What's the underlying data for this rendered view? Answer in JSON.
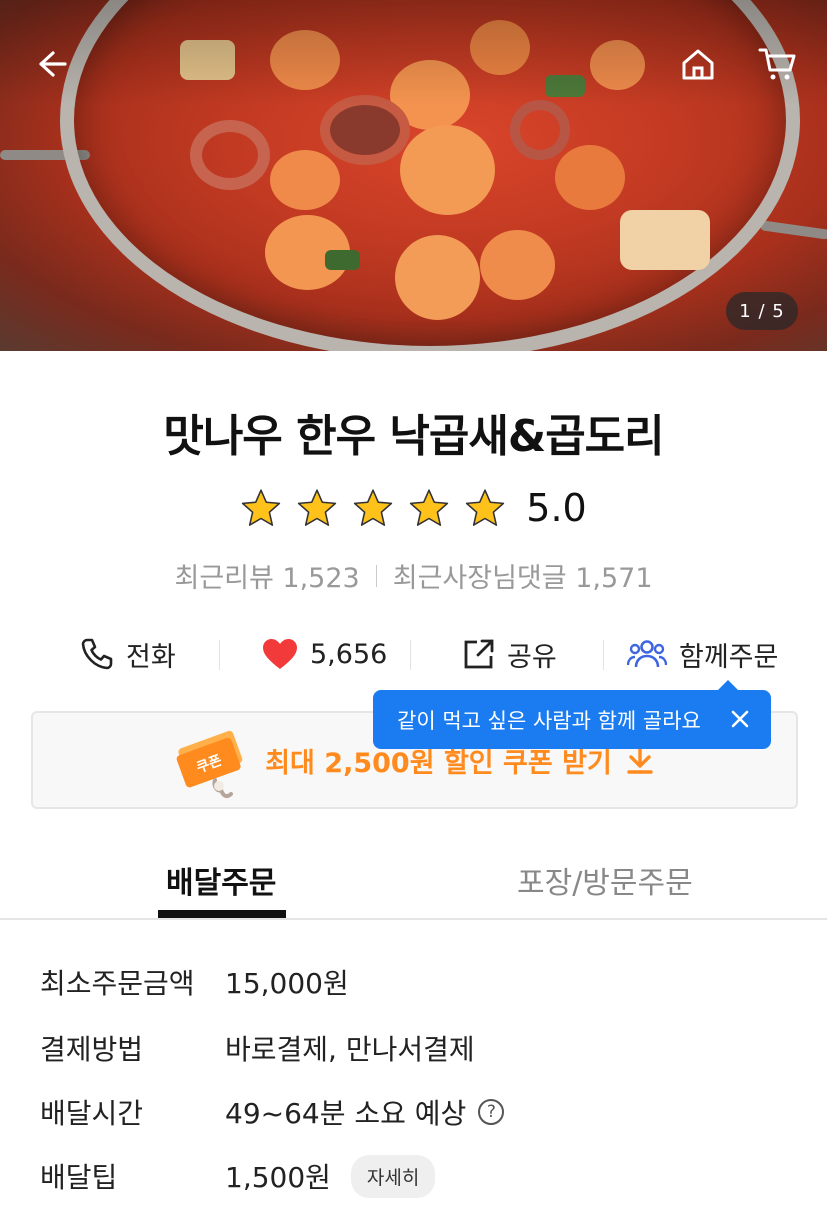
{
  "hero": {
    "counter": "1 / 5",
    "icons": [
      "back-arrow-icon",
      "home-icon",
      "cart-icon"
    ]
  },
  "store": {
    "name": "맛나우 한우 낙곱새&곱도리",
    "rating": "5.0",
    "rating_stars": 5,
    "recent_reviews": "최근리뷰 1,523",
    "owner_replies": "최근사장님댓글 1,571"
  },
  "actions": {
    "call": "전화",
    "likes": "5,656",
    "share": "공유",
    "group_order": "함께주문"
  },
  "tooltip": {
    "text": "같이 먹고 싶은 사람과 함께 골라요"
  },
  "coupon": {
    "badge": "쿠폰",
    "text": "최대 2,500원 할인 쿠폰 받기"
  },
  "tabs": {
    "delivery": "배달주문",
    "pickup": "포장/방문주문"
  },
  "info": {
    "min_order_label": "최소주문금액",
    "min_order_value": "15,000원",
    "payment_label": "결제방법",
    "payment_value": "바로결제, 만나서결제",
    "delivery_time_label": "배달시간",
    "delivery_time_value": "49~64분 소요 예상",
    "delivery_tip_label": "배달팁",
    "delivery_tip_value": "1,500원",
    "detail_chip": "자세히"
  },
  "colors": {
    "accent_blue": "#1b7cf2",
    "coupon_orange": "#ff8a1d",
    "heart_red": "#f23a3a",
    "star_yellow": "#ffc21a"
  }
}
